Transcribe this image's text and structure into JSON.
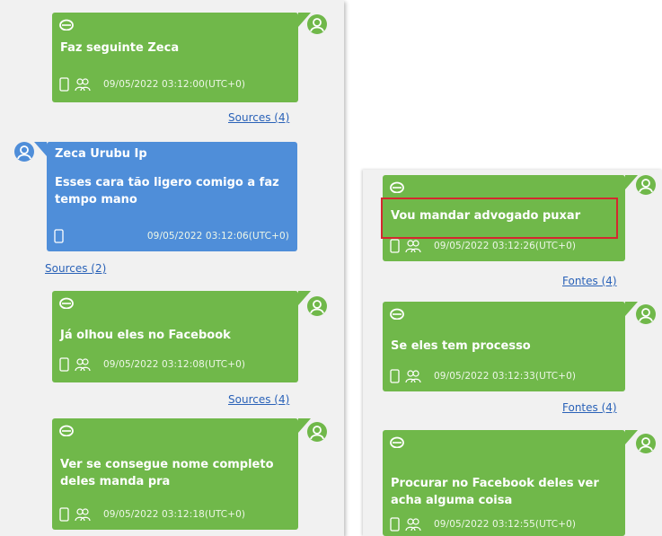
{
  "left_column": {
    "msg1": {
      "text": "Faz seguinte Zeca",
      "timestamp": "09/05/2022 03:12:00(UTC+0)",
      "sources_label": "Sources (4)"
    },
    "msg2": {
      "sender": "Zeca Urubu Ip",
      "text": "Esses cara tão ligero comigo a faz tempo mano",
      "timestamp": "09/05/2022 03:12:06(UTC+0)",
      "sources_label": "Sources (2)"
    },
    "msg3": {
      "text": "Já olhou eles no Facebook",
      "timestamp": "09/05/2022 03:12:08(UTC+0)",
      "sources_label": "Sources (4)"
    },
    "msg4": {
      "text": "Ver se consegue nome completo deles manda pra",
      "timestamp": "09/05/2022 03:12:18(UTC+0)"
    }
  },
  "right_column": {
    "msg1": {
      "text": "Vou mandar advogado puxar",
      "timestamp": "09/05/2022 03:12:26(UTC+0)",
      "sources_label": "Fontes (4)"
    },
    "msg2": {
      "text": "Se eles tem processo",
      "timestamp": "09/05/2022 03:12:33(UTC+0)",
      "sources_label": "Fontes (4)"
    },
    "msg3": {
      "text": "Procurar no Facebook deles ver acha alguma coisa",
      "timestamp": "09/05/2022 03:12:55(UTC+0)"
    }
  },
  "icons": {
    "sender": "app-icon",
    "device": "phone-icon",
    "participants": "group-icon",
    "avatar": "user-avatar-icon"
  },
  "colors": {
    "outgoing_bubble": "#70b84a",
    "incoming_bubble": "#4f8ed9",
    "link": "#2a62b8",
    "highlight_box": "#d4282f"
  }
}
